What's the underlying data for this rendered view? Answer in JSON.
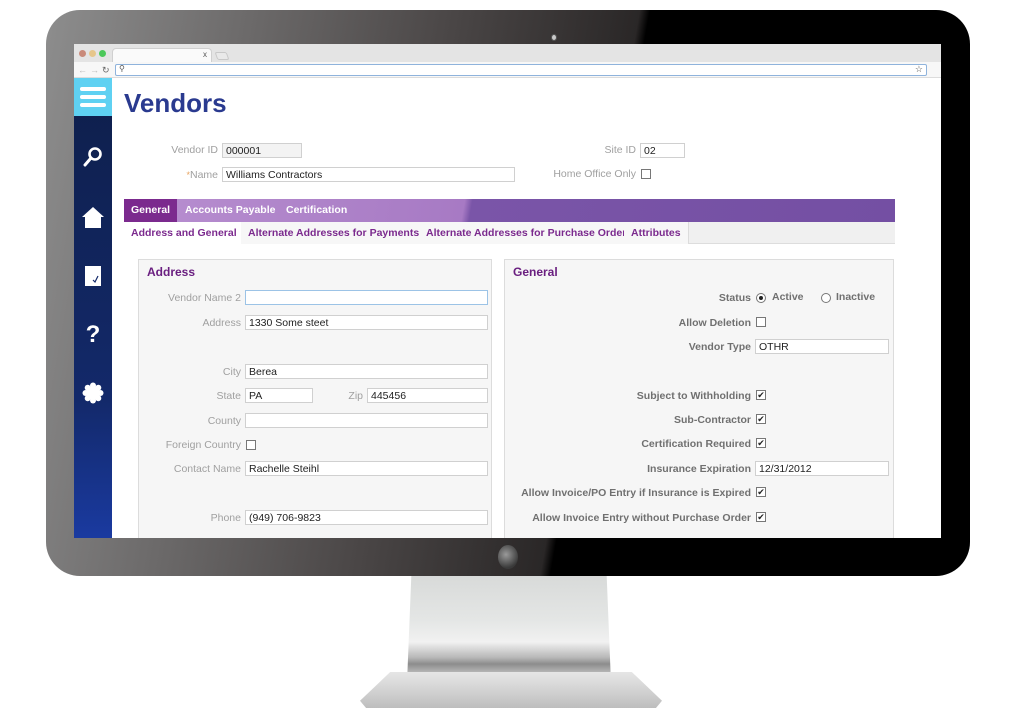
{
  "browser": {
    "tab_close": "x",
    "url": ""
  },
  "sidebar": {
    "items": [
      {
        "name": "menu",
        "icon": "hamburger-icon"
      },
      {
        "name": "search",
        "icon": "search-icon"
      },
      {
        "name": "home",
        "icon": "home-icon"
      },
      {
        "name": "documents",
        "icon": "document-check-icon"
      },
      {
        "name": "help",
        "icon": "help-icon"
      },
      {
        "name": "settings",
        "icon": "gear-icon"
      }
    ]
  },
  "page": {
    "title": "Vendors"
  },
  "header_form": {
    "vendor_id_label": "Vendor ID",
    "vendor_id_value": "000001",
    "name_required_mark": "*",
    "name_label": "Name",
    "name_value": "Williams Contractors",
    "site_id_label": "Site ID",
    "site_id_value": "02",
    "home_office_label": "Home Office Only",
    "home_office_checked": false
  },
  "main_tabs": [
    {
      "label": "General",
      "active": true
    },
    {
      "label": "Accounts Payable",
      "active": false
    },
    {
      "label": "Certification",
      "active": false
    }
  ],
  "sub_tabs": [
    {
      "label": "Address and General",
      "active": true
    },
    {
      "label": "Alternate Addresses for Payments",
      "active": false
    },
    {
      "label": "Alternate Addresses for Purchase Order",
      "active": false
    },
    {
      "label": "Attributes",
      "active": false
    }
  ],
  "address": {
    "title": "Address",
    "vendor_name2_label": "Vendor Name 2",
    "vendor_name2_value": "",
    "address_label": "Address",
    "address_value": "1330 Some steet",
    "city_label": "City",
    "city_value": "Berea",
    "state_label": "State",
    "state_value": "PA",
    "zip_label": "Zip",
    "zip_value": "445456",
    "county_label": "County",
    "county_value": "",
    "foreign_country_label": "Foreign Country",
    "foreign_country_checked": false,
    "contact_name_label": "Contact Name",
    "contact_name_value": "Rachelle Steihl",
    "phone_label": "Phone",
    "phone_value": "(949) 706-9823"
  },
  "general": {
    "title": "General",
    "status_label": "Status",
    "status_options": [
      "Active",
      "Inactive"
    ],
    "status_selected": "Active",
    "allow_deletion_label": "Allow Deletion",
    "allow_deletion_checked": false,
    "vendor_type_label": "Vendor Type",
    "vendor_type_value": "OTHR",
    "subject_withholding_label": "Subject to Withholding",
    "subject_withholding_checked": true,
    "sub_contractor_label": "Sub-Contractor",
    "sub_contractor_checked": true,
    "certification_required_label": "Certification Required",
    "certification_required_checked": true,
    "insurance_expiration_label": "Insurance Expiration",
    "insurance_expiration_value": "12/31/2012",
    "allow_invoice_po_label": "Allow Invoice/PO Entry if Insurance is Expired",
    "allow_invoice_po_checked": true,
    "allow_invoice_no_po_label": "Allow Invoice Entry without Purchase Order",
    "allow_invoice_no_po_checked": true
  },
  "glyphs": {
    "check": "✔",
    "back": "←",
    "forward": "→",
    "reload": "↻",
    "search": "⚲",
    "star": "☆",
    "help": "?"
  }
}
